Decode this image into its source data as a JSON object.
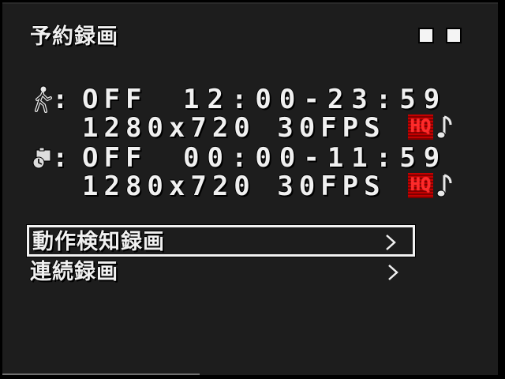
{
  "title": "予約録画",
  "motion_schedule": {
    "icon": "walking-person-icon",
    "colon": ":",
    "status": "OFF",
    "time_range": "12:00-23:59",
    "resolution_fps": "1280x720 30FPS",
    "quality_badge": "HQ",
    "audio_icon": "music-note-icon"
  },
  "continuous_schedule": {
    "icon": "camera-clock-icon",
    "colon": ":",
    "status": "OFF",
    "time_range": "00:00-11:59",
    "resolution_fps": "1280x720 30FPS",
    "quality_badge": "HQ",
    "audio_icon": "music-note-icon"
  },
  "menu": {
    "items": [
      {
        "label": "動作検知録画",
        "selected": true
      },
      {
        "label": "連続録画",
        "selected": false
      }
    ]
  },
  "colors": {
    "background": "#1d1d1d",
    "text": "#f0f0f0",
    "hq_badge": "#c40000"
  }
}
